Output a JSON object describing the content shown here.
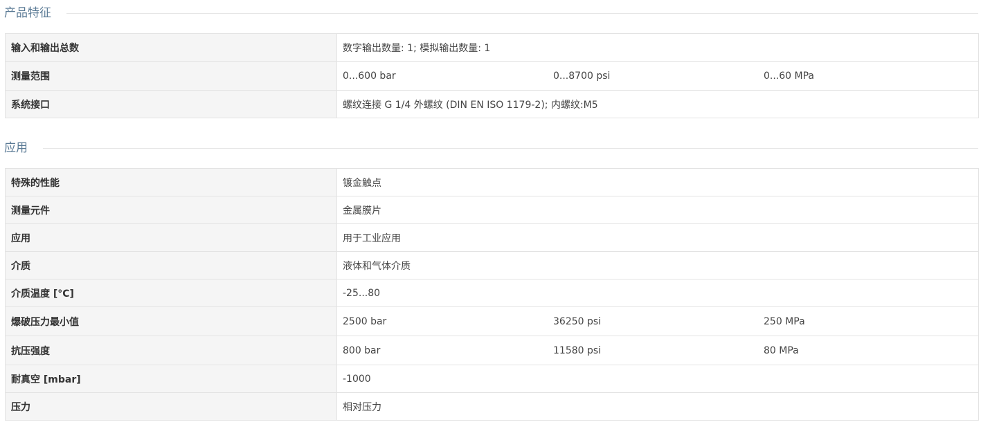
{
  "sections": [
    {
      "title": "产品特征",
      "rows": [
        {
          "label": "输入和输出总数",
          "values": [
            "数字输出数量: 1; 模拟输出数量: 1"
          ]
        },
        {
          "label": "测量范围",
          "values": [
            "0...600 bar",
            "0...8700 psi",
            "0...60 MPa"
          ]
        },
        {
          "label": "系统接口",
          "values": [
            "螺纹连接 G 1/4 外螺纹 (DIN EN ISO 1179-2); 内螺纹:M5"
          ]
        }
      ]
    },
    {
      "title": "应用",
      "rows": [
        {
          "label": "特殊的性能",
          "values": [
            "镀金触点"
          ]
        },
        {
          "label": "测量元件",
          "values": [
            "金属膜片"
          ]
        },
        {
          "label": "应用",
          "values": [
            "用于工业应用"
          ]
        },
        {
          "label": "介质",
          "values": [
            "液体和气体介质"
          ]
        },
        {
          "label": "介质温度 [°C]",
          "values": [
            "-25...80"
          ]
        },
        {
          "label": "爆破压力最小值",
          "values": [
            "2500 bar",
            "36250 psi",
            "250 MPa"
          ]
        },
        {
          "label": "抗压强度",
          "values": [
            "800 bar",
            "11580 psi",
            "80 MPa"
          ]
        },
        {
          "label": "耐真空 [mbar]",
          "values": [
            "-1000"
          ]
        },
        {
          "label": "压力",
          "values": [
            "相对压力"
          ]
        }
      ]
    }
  ]
}
